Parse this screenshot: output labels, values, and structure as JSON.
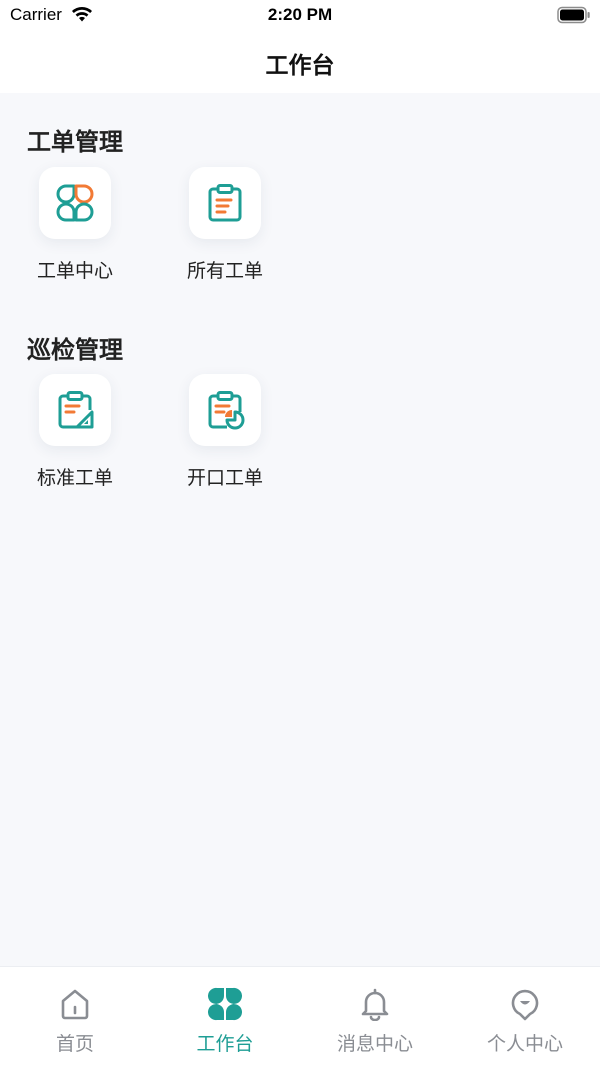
{
  "status_bar": {
    "carrier": "Carrier",
    "time": "2:20 PM"
  },
  "nav": {
    "title": "工作台"
  },
  "sections": [
    {
      "title": "工单管理",
      "items": [
        {
          "label": "工单中心",
          "icon": "clover-grid-icon"
        },
        {
          "label": "所有工单",
          "icon": "clipboard-list-icon"
        }
      ]
    },
    {
      "title": "巡检管理",
      "items": [
        {
          "label": "标准工单",
          "icon": "clipboard-ruler-icon"
        },
        {
          "label": "开口工单",
          "icon": "clipboard-pie-icon"
        }
      ]
    }
  ],
  "tabbar": {
    "items": [
      {
        "label": "首页",
        "icon": "home-icon",
        "active": false
      },
      {
        "label": "工作台",
        "icon": "clover-grid-icon",
        "active": true
      },
      {
        "label": "消息中心",
        "icon": "bell-icon",
        "active": false
      },
      {
        "label": "个人中心",
        "icon": "user-face-icon",
        "active": false
      }
    ]
  },
  "colors": {
    "accent": "#1e9e95",
    "accent_orange": "#f27a35",
    "inactive": "#8a8d93",
    "background": "#f7f8fb"
  }
}
